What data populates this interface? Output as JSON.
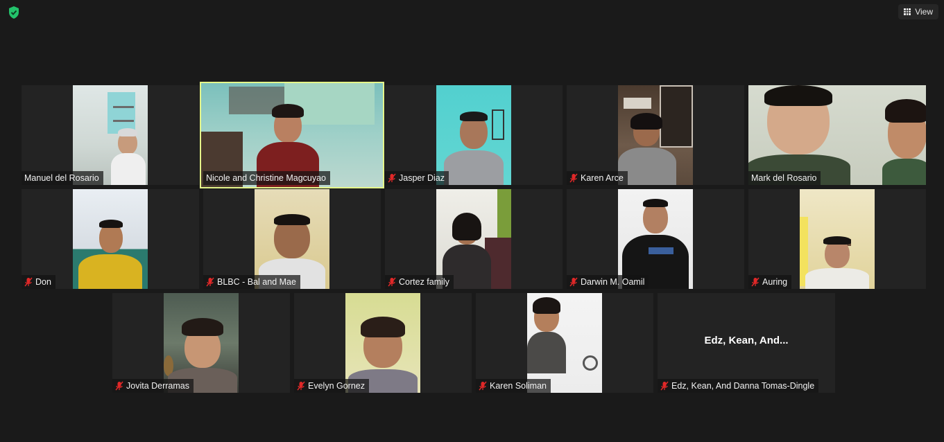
{
  "toolbar": {
    "view_label": "View"
  },
  "participants": [
    {
      "name": "Manuel del Rosario",
      "muted": false
    },
    {
      "name": "Nicole and Christine Magcuyao",
      "muted": false,
      "active_speaker": true
    },
    {
      "name": "Jasper Diaz",
      "muted": true
    },
    {
      "name": "Karen Arce",
      "muted": true
    },
    {
      "name": "Mark del Rosario",
      "muted": false
    },
    {
      "name": "Don",
      "muted": true
    },
    {
      "name": "BLBC - Bal and Mae",
      "muted": true
    },
    {
      "name": "Cortez family",
      "muted": true
    },
    {
      "name": "Darwin M. Oamil",
      "muted": true
    },
    {
      "name": "Auring",
      "muted": true
    },
    {
      "name": "Jovita Derramas",
      "muted": true
    },
    {
      "name": "Evelyn Gornez",
      "muted": true
    },
    {
      "name": "Karen Soliman",
      "muted": true
    },
    {
      "name": "Edz, Kean, And Danna Tomas-Dingle",
      "muted": true,
      "video_off": true,
      "display_short": "Edz, Kean, And..."
    }
  ],
  "colors": {
    "active_border": "#e4f58a",
    "mute_red": "#e02828",
    "shield_green": "#23c26b"
  }
}
